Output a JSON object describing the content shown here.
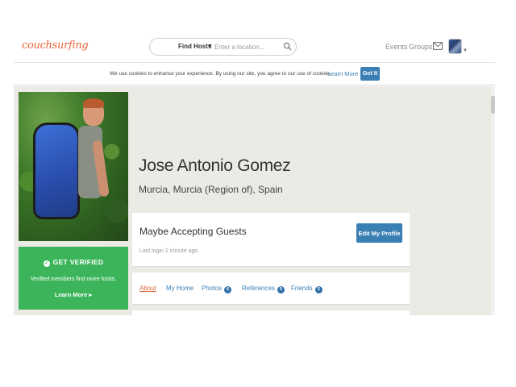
{
  "header": {
    "logo": "couchsurfing",
    "search_mode": "Find Hosts",
    "search_placeholder": "Enter a location...",
    "nav_events": "Events",
    "nav_groups": "Groups"
  },
  "cookie_bar": {
    "text": "We use cookies to enhance your experience. By using our site, you agree to our use of cookies.",
    "learn_more": "Learn More",
    "got_it": "Got It"
  },
  "verify": {
    "title": "GET VERIFIED",
    "description": "Verified members find more hosts.",
    "link": "Learn More ▸"
  },
  "profile": {
    "name": "Jose Antonio Gomez",
    "location": "Murcia, Murcia (Region of), Spain",
    "status": "Maybe Accepting Guests",
    "last_login": "Last login 1 minute ago",
    "edit_button": "Edit My Profile"
  },
  "tabs": [
    {
      "label": "About",
      "badge": null,
      "active": true
    },
    {
      "label": "My Home",
      "badge": null,
      "active": false
    },
    {
      "label": "Photos",
      "badge": "6",
      "active": false
    },
    {
      "label": "References",
      "badge": "5",
      "active": false
    },
    {
      "label": "Friends",
      "badge": "3",
      "active": false
    }
  ],
  "colors": {
    "brand": "#e8643c",
    "link": "#3b7fb5",
    "verify_green": "#3cb55a"
  }
}
